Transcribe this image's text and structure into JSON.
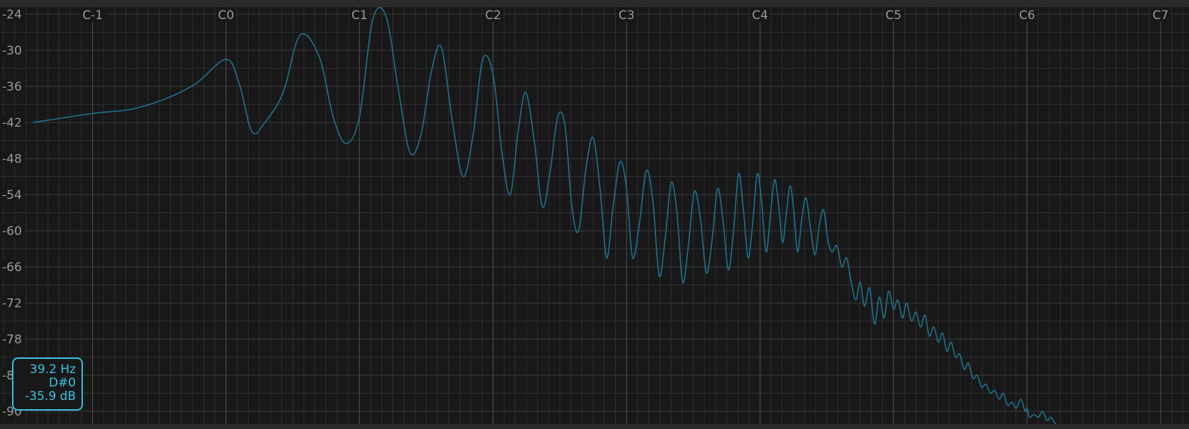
{
  "colors": {
    "background": "#181818",
    "major_grid": "#4a4a4a",
    "minor_grid": "#2e2e2e",
    "curve": "#1f6e86",
    "readout_accent": "#37c3e6"
  },
  "readout": {
    "frequency": "39.2 Hz",
    "note": "D#0",
    "level": "-35.9 dB"
  },
  "chart_data": {
    "type": "line",
    "title": "",
    "xlabel": "",
    "ylabel": "",
    "x_scale": "log",
    "x_tick_labels": [
      "C-1",
      "C0",
      "C1",
      "C2",
      "C3",
      "C4",
      "C5",
      "C6",
      "C7"
    ],
    "x_tick_freqs_hz": [
      8.18,
      16.35,
      32.7,
      65.41,
      130.81,
      261.63,
      523.25,
      1046.5,
      2093.0
    ],
    "y_tick_labels": [
      "-24",
      "-30",
      "-36",
      "-42",
      "-48",
      "-54",
      "-60",
      "-66",
      "-72",
      "-78",
      "-84",
      "-90"
    ],
    "ylim": [
      -91,
      -24
    ],
    "grid": true,
    "series": [
      {
        "x_hz": [
          6.0,
          8.18,
          10.0,
          12.0,
          14.0,
          16.35,
          17.5,
          18.7,
          20.0,
          22.0,
          24.0,
          26.5,
          28.5,
          30.5,
          32.7,
          35.0,
          37.5,
          40.0,
          42.5,
          45.0,
          47.5,
          50.0,
          53.0,
          56.0,
          59.0,
          62.0,
          65.41,
          68.5,
          71.5,
          74.5,
          77.5,
          81.0,
          84.5,
          88.0,
          91.5,
          95.0,
          98.5,
          102.0,
          106.0,
          110.0,
          114.0,
          118.0,
          122.0,
          126.5,
          130.81,
          135.0,
          140.0,
          145.0,
          150.0,
          155.0,
          160.0,
          165.0,
          170.0,
          175.0,
          180.0,
          186.0,
          192.0,
          198.0,
          204.0,
          210.0,
          216.0,
          222.0,
          228.0,
          234.0,
          240.0,
          246.0,
          252.0,
          258.0,
          264.0,
          270.0,
          276.0,
          282.0,
          288.0,
          294.0,
          300.0,
          306.0,
          312.0,
          318.0,
          325.0,
          332.0,
          340.0,
          348.0,
          356.0,
          364.0,
          372.0,
          380.0,
          390.0,
          400.0,
          410.0,
          420.0,
          430.0,
          440.0,
          450.0,
          462.0,
          474.0,
          486.0,
          498.0,
          510.0,
          523.25,
          535.0,
          548.0,
          560.0,
          574.0,
          588.0,
          602.0,
          616.0,
          630.0,
          645.0,
          660.0,
          675.0,
          690.0,
          706.0,
          722.0,
          738.0,
          755.0,
          772.0,
          790.0,
          808.0,
          826.0,
          845.0,
          865.0,
          885.0,
          905.0,
          925.0,
          946.0,
          968.0,
          990.0,
          1013.0,
          1036.0,
          1046.5,
          1060.0,
          1085.0,
          1110.0,
          1135.0,
          1160.0,
          1185.0,
          1210.0,
          1245.0
        ],
        "y_db": [
          -42.0,
          -40.5,
          -39.8,
          -38.0,
          -35.5,
          -31.5,
          -35.5,
          -43.5,
          -42.0,
          -37.0,
          -27.5,
          -31.0,
          -41.0,
          -45.5,
          -41.0,
          -25.0,
          -24.3,
          -36.5,
          -47.0,
          -44.0,
          -33.5,
          -29.5,
          -42.0,
          -51.0,
          -44.0,
          -31.5,
          -34.0,
          -47.0,
          -54.0,
          -43.5,
          -37.0,
          -45.0,
          -56.0,
          -50.0,
          -41.0,
          -42.5,
          -56.0,
          -60.0,
          -49.5,
          -44.5,
          -53.0,
          -64.5,
          -56.0,
          -48.5,
          -53.0,
          -64.5,
          -58.5,
          -50.0,
          -55.0,
          -67.5,
          -61.0,
          -52.0,
          -57.0,
          -68.5,
          -63.0,
          -53.5,
          -58.0,
          -67.0,
          -61.5,
          -53.0,
          -58.5,
          -66.5,
          -60.0,
          -50.5,
          -56.5,
          -64.5,
          -58.5,
          -50.5,
          -55.5,
          -63.5,
          -57.5,
          -51.5,
          -55.5,
          -62.0,
          -57.0,
          -52.5,
          -57.0,
          -63.5,
          -58.0,
          -54.5,
          -59.5,
          -64.0,
          -59.0,
          -56.5,
          -61.5,
          -63.5,
          -62.5,
          -66.0,
          -64.5,
          -68.5,
          -71.5,
          -68.5,
          -72.5,
          -69.5,
          -75.5,
          -71.0,
          -74.5,
          -70.0,
          -73.0,
          -71.5,
          -74.5,
          -72.0,
          -75.0,
          -73.5,
          -76.0,
          -74.0,
          -77.5,
          -76.0,
          -78.5,
          -77.0,
          -80.0,
          -78.5,
          -81.0,
          -80.5,
          -83.0,
          -82.0,
          -84.5,
          -84.0,
          -86.0,
          -85.5,
          -87.0,
          -86.5,
          -88.0,
          -87.0,
          -89.0,
          -88.5,
          -89.5,
          -88.0,
          -90.0,
          -89.5,
          -91.0,
          -90.5,
          -91.0,
          -90.0,
          -91.5,
          -91.0,
          -92.0,
          -93.0
        ]
      }
    ]
  }
}
